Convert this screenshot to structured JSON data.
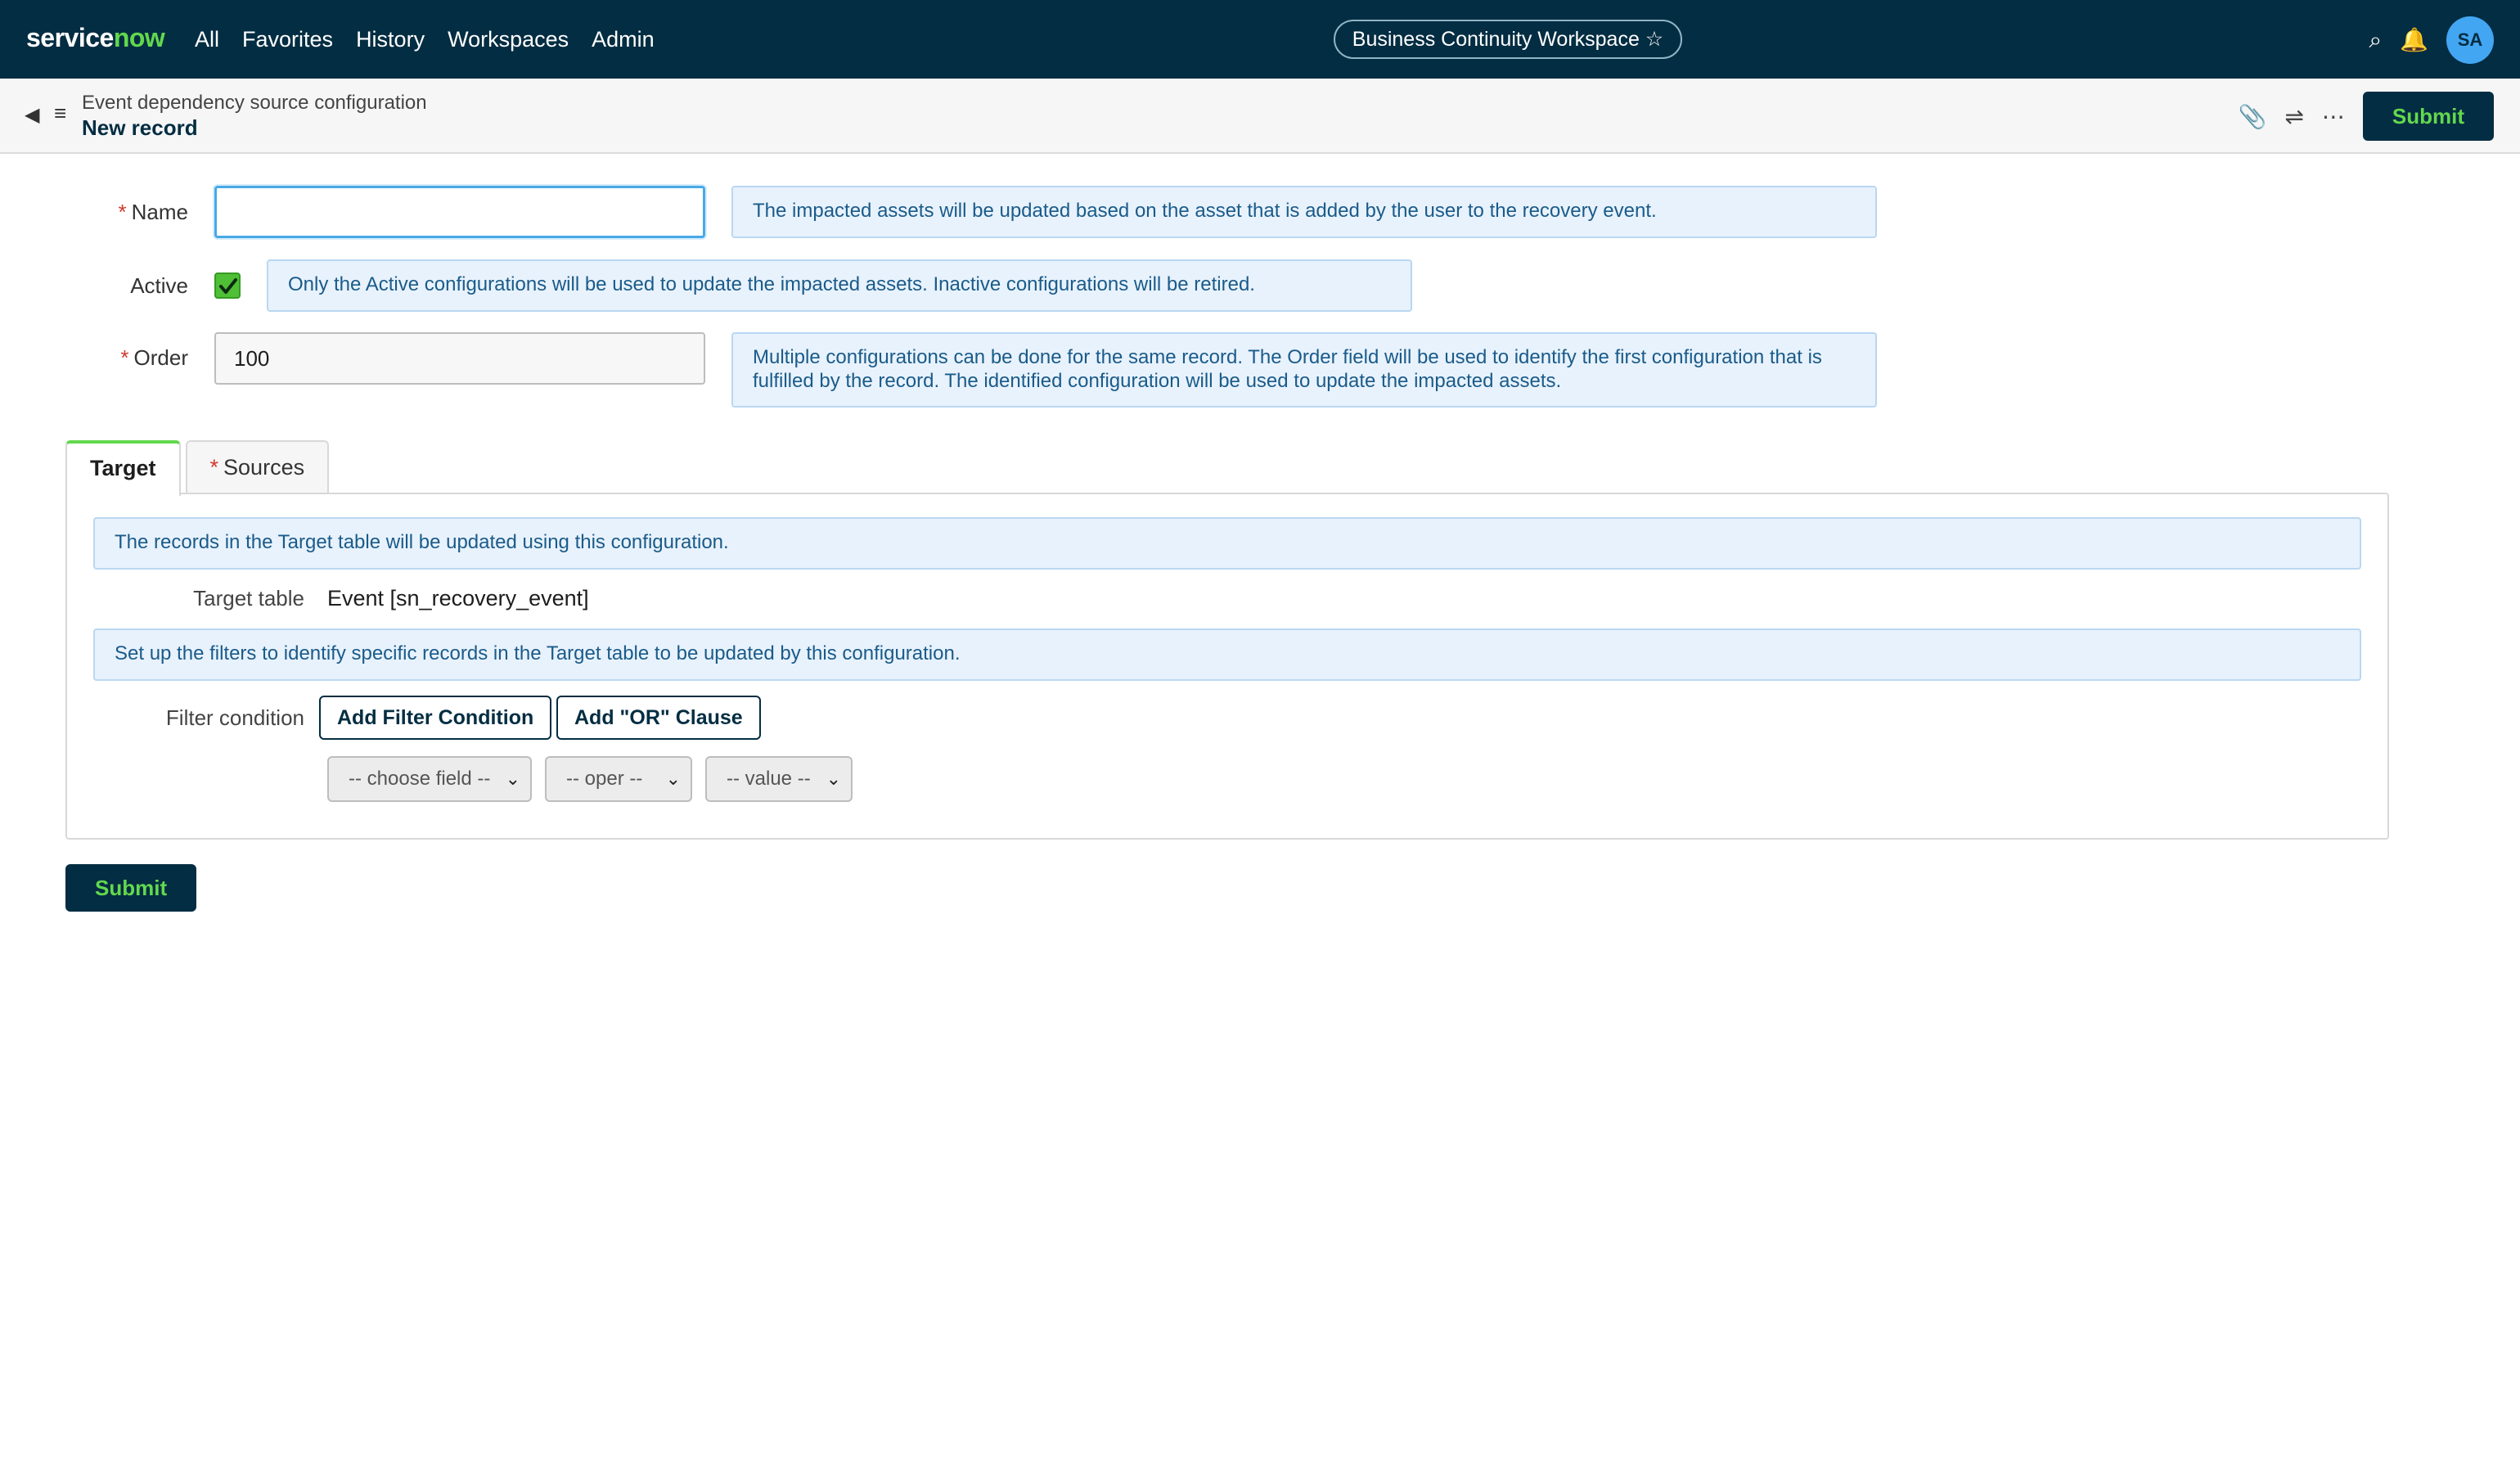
{
  "app": {
    "logo_part1": "service",
    "logo_part2": "now"
  },
  "nav": {
    "items": [
      "All",
      "Favorites",
      "History",
      "Workspaces",
      "Admin"
    ]
  },
  "workspace_pill": "Business Continuity Workspace ☆",
  "header_icons": {
    "search": "search-icon",
    "notifications": "bell-icon"
  },
  "user": {
    "initials": "SA"
  },
  "record": {
    "breadcrumb": "Event dependency source configuration",
    "title": "New record",
    "submit_label": "Submit"
  },
  "fields": {
    "name": {
      "label": "Name",
      "required": "*",
      "value": "",
      "info": "The impacted assets will be updated based on the asset that is added by the user to the recovery event."
    },
    "active": {
      "label": "Active",
      "checked": true,
      "info": "Only the Active configurations will be used to update the impacted assets. Inactive configurations will be retired."
    },
    "order": {
      "label": "Order",
      "required": "*",
      "value": "100",
      "info": "Multiple configurations can be done for the same record. The Order field will be used to identify the first configuration that is fulfilled by the record. The identified configuration will be used to update the impacted assets."
    }
  },
  "tabs": [
    {
      "label": "Target",
      "active": true
    },
    {
      "label": "Sources",
      "required": "*",
      "active": false
    }
  ],
  "target_tab": {
    "info_1": "The records in the Target table will be updated using this configuration.",
    "target_table_label": "Target table",
    "target_table_value": "Event [sn_recovery_event]",
    "info_2": "Set up the filters to identify specific records in the Target table to be updated by this configuration.",
    "filter_label": "Filter condition",
    "add_filter_label": "Add Filter Condition",
    "add_or_label": "Add \"OR\" Clause",
    "selects": {
      "field": "-- choose field --",
      "oper": "-- oper --",
      "value": "-- value --"
    }
  },
  "footer": {
    "submit_label": "Submit"
  },
  "colors": {
    "nav_bg": "#032d42",
    "accent": "#62d84e",
    "info_bg": "#e8f2fc"
  }
}
